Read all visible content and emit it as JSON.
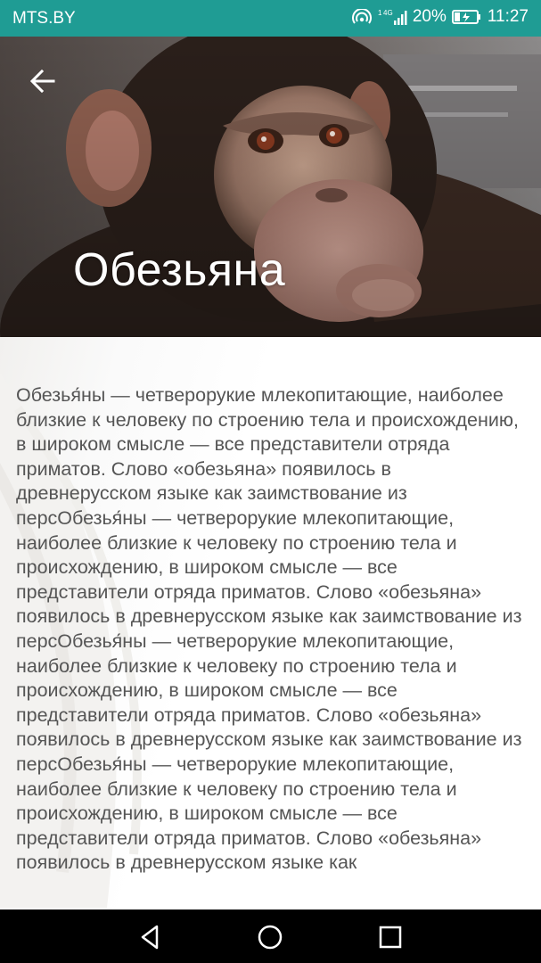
{
  "status_bar": {
    "carrier": "MTS.BY",
    "network": "4G",
    "battery_percent": "20%",
    "time": "11:27"
  },
  "header": {
    "title": "Обезьяна"
  },
  "article": {
    "body": "Обезья́ны — четверорукие млекопитающие, наиболее близкие к человеку по строению тела и происхождению, в широком смысле — все представители отряда приматов. Слово «обезьяна» появилось в древнерусском языке как заимствование из персОбезья́ны — четверорукие млекопитающие, наиболее близкие к человеку по строению тела и происхождению, в широком смысле — все представители отряда приматов. Слово «обезьяна» появилось в древнерусском языке как заимствование из персОбезья́ны — четверорукие млекопитающие, наиболее близкие к человеку по строению тела и происхождению, в широком смысле — все представители отряда приматов. Слово «обезьяна» появилось в древнерусском языке как заимствование из персОбезья́ны — четверорукие млекопитающие, наиболее близкие к человеку по строению тела и происхождению, в широком смысле — все представители отряда приматов. Слово «обезьяна» появилось в древнерусском языке как"
  },
  "icons": {
    "back": "arrow-left-icon",
    "nav_back": "triangle-back-icon",
    "nav_home": "circle-home-icon",
    "nav_recent": "square-recent-icon"
  },
  "colors": {
    "status_bar": "#1f9c94",
    "text": "#555555",
    "title": "#ffffff"
  }
}
